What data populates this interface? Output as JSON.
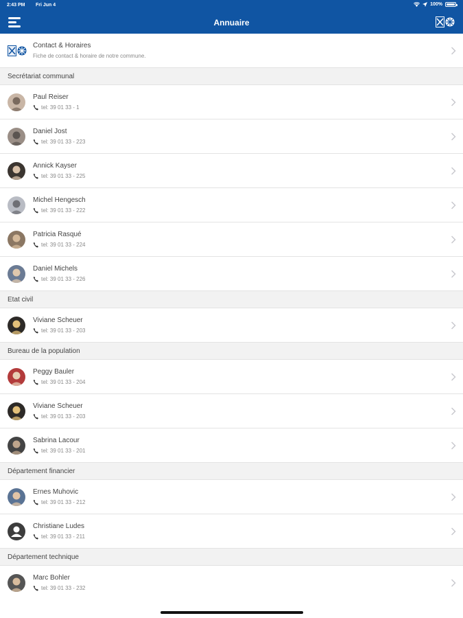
{
  "status_bar": {
    "time": "2:43 PM",
    "date": "Fri Jun 4",
    "battery": "100%"
  },
  "nav": {
    "title": "Annuaire",
    "menu_icon": "menu-icon",
    "logo_icon": "commune-logo-icon"
  },
  "contact_row": {
    "title": "Contact & Horaires",
    "subtitle": "Fiche de contact & horaire de notre commune."
  },
  "sections": [
    {
      "title": "Secrétariat communal",
      "people": [
        {
          "name": "Paul Reiser",
          "phone": "tel: 39 01 33 - 1"
        },
        {
          "name": "Daniel Jost",
          "phone": "tel: 39 01 33 - 223"
        },
        {
          "name": "Annick Kayser",
          "phone": "tel: 39 01 33 - 225"
        },
        {
          "name": "Michel Hengesch",
          "phone": "tel: 39 01 33 - 222"
        },
        {
          "name": "Patricia Rasqué",
          "phone": "tel: 39 01 33 - 224"
        },
        {
          "name": "Daniel Michels",
          "phone": "tel: 39 01 33 - 226"
        }
      ]
    },
    {
      "title": "Etat civil",
      "people": [
        {
          "name": "Viviane Scheuer",
          "phone": "tel: 39 01 33 - 203"
        }
      ]
    },
    {
      "title": "Bureau de la population",
      "people": [
        {
          "name": "Peggy Bauler",
          "phone": "tel: 39 01 33 - 204"
        },
        {
          "name": "Viviane Scheuer",
          "phone": "tel: 39 01 33 - 203"
        },
        {
          "name": "Sabrina Lacour",
          "phone": "tel: 39 01 33 - 201"
        }
      ]
    },
    {
      "title": "Département financier",
      "people": [
        {
          "name": "Ernes Muhovic",
          "phone": "tel: 39 01 33 - 212"
        },
        {
          "name": "Christiane Ludes",
          "phone": "tel: 39 01 33 - 211"
        }
      ]
    },
    {
      "title": "Département technique",
      "people": [
        {
          "name": "Marc Bohler",
          "phone": "tel: 39 01 33 - 232"
        }
      ]
    }
  ],
  "colors": {
    "header": "#1055a3",
    "section_bg": "#f2f2f2",
    "separator": "#e3e3e3"
  }
}
